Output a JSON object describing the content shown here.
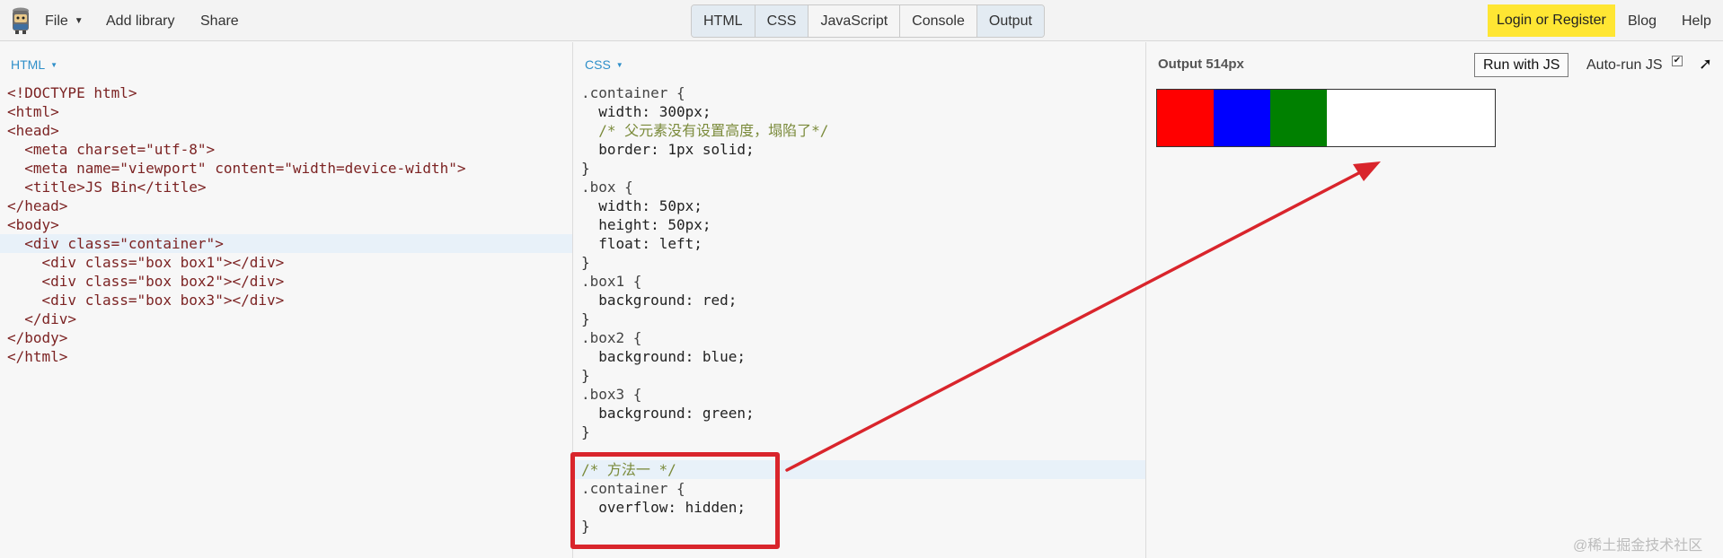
{
  "toolbar": {
    "file_label": "File",
    "add_library_label": "Add library",
    "share_label": "Share",
    "panel_tabs": [
      "HTML",
      "CSS",
      "JavaScript",
      "Console",
      "Output"
    ],
    "login_label": "Login or Register",
    "blog_label": "Blog",
    "help_label": "Help"
  },
  "html_panel": {
    "label": "HTML",
    "lines": [
      "<!DOCTYPE html>",
      "<html>",
      "<head>",
      "  <meta charset=\"utf-8\">",
      "  <meta name=\"viewport\" content=\"width=device-width\">",
      "  <title>JS Bin</title>",
      "</head>",
      "<body>",
      "  <div class=\"container\">",
      "    <div class=\"box box1\"></div>",
      "    <div class=\"box box2\"></div>",
      "    <div class=\"box box3\"></div>",
      "  </div>",
      "</body>",
      "</html>"
    ]
  },
  "css_panel": {
    "label": "CSS",
    "lines": [
      ".container {",
      "  width: 300px;",
      "  /* 父元素没有设置高度，塌陷了*/",
      "  border: 1px solid;",
      "}",
      ".box {",
      "  width: 50px;",
      "  height: 50px;",
      "  float: left;",
      "}",
      ".box1 {",
      "  background: red;",
      "}",
      ".box2 {",
      "  background: blue;",
      "}",
      ".box3 {",
      "  background: green;",
      "}",
      "",
      "/* 方法一 */",
      ".container {",
      "  overflow: hidden;",
      "}"
    ]
  },
  "output_panel": {
    "label": "Output 514px",
    "run_label": "Run with JS",
    "autorun_label": "Auto-run JS",
    "autorun_checked": true,
    "popout_icon": "popout-arrow-icon",
    "boxes": [
      {
        "color": "#ff0000"
      },
      {
        "color": "#0000ff"
      },
      {
        "color": "#008000"
      }
    ]
  },
  "colors": {
    "accent": "#2f8fc9",
    "login_bg": "#ffe633",
    "annotation": "#d9252c"
  },
  "watermark": "@稀土掘金技术社区"
}
